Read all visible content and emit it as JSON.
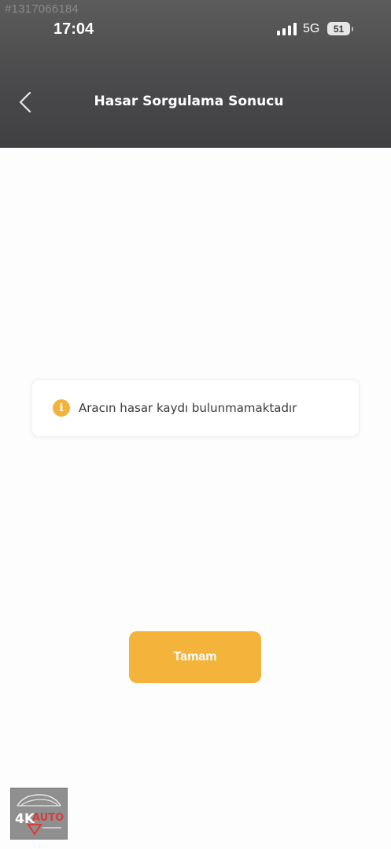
{
  "watermark": {
    "id_text": "#1317066184"
  },
  "status_bar": {
    "time": "17:04",
    "network": "5G",
    "battery_level": "51"
  },
  "header": {
    "title": "Hasar Sorgulama Sonucu",
    "back_icon": "chevron-left-icon"
  },
  "notice": {
    "icon": "info-icon",
    "icon_glyph": "i",
    "message": "Aracın hasar kaydı bulunmamaktadır"
  },
  "actions": {
    "ok_label": "Tamam"
  },
  "logo": {
    "brand": "4KAUTO"
  },
  "colors": {
    "header_background": "#4a4a4c",
    "accent": "#f4b43c",
    "page_background": "#fdfdfd"
  }
}
